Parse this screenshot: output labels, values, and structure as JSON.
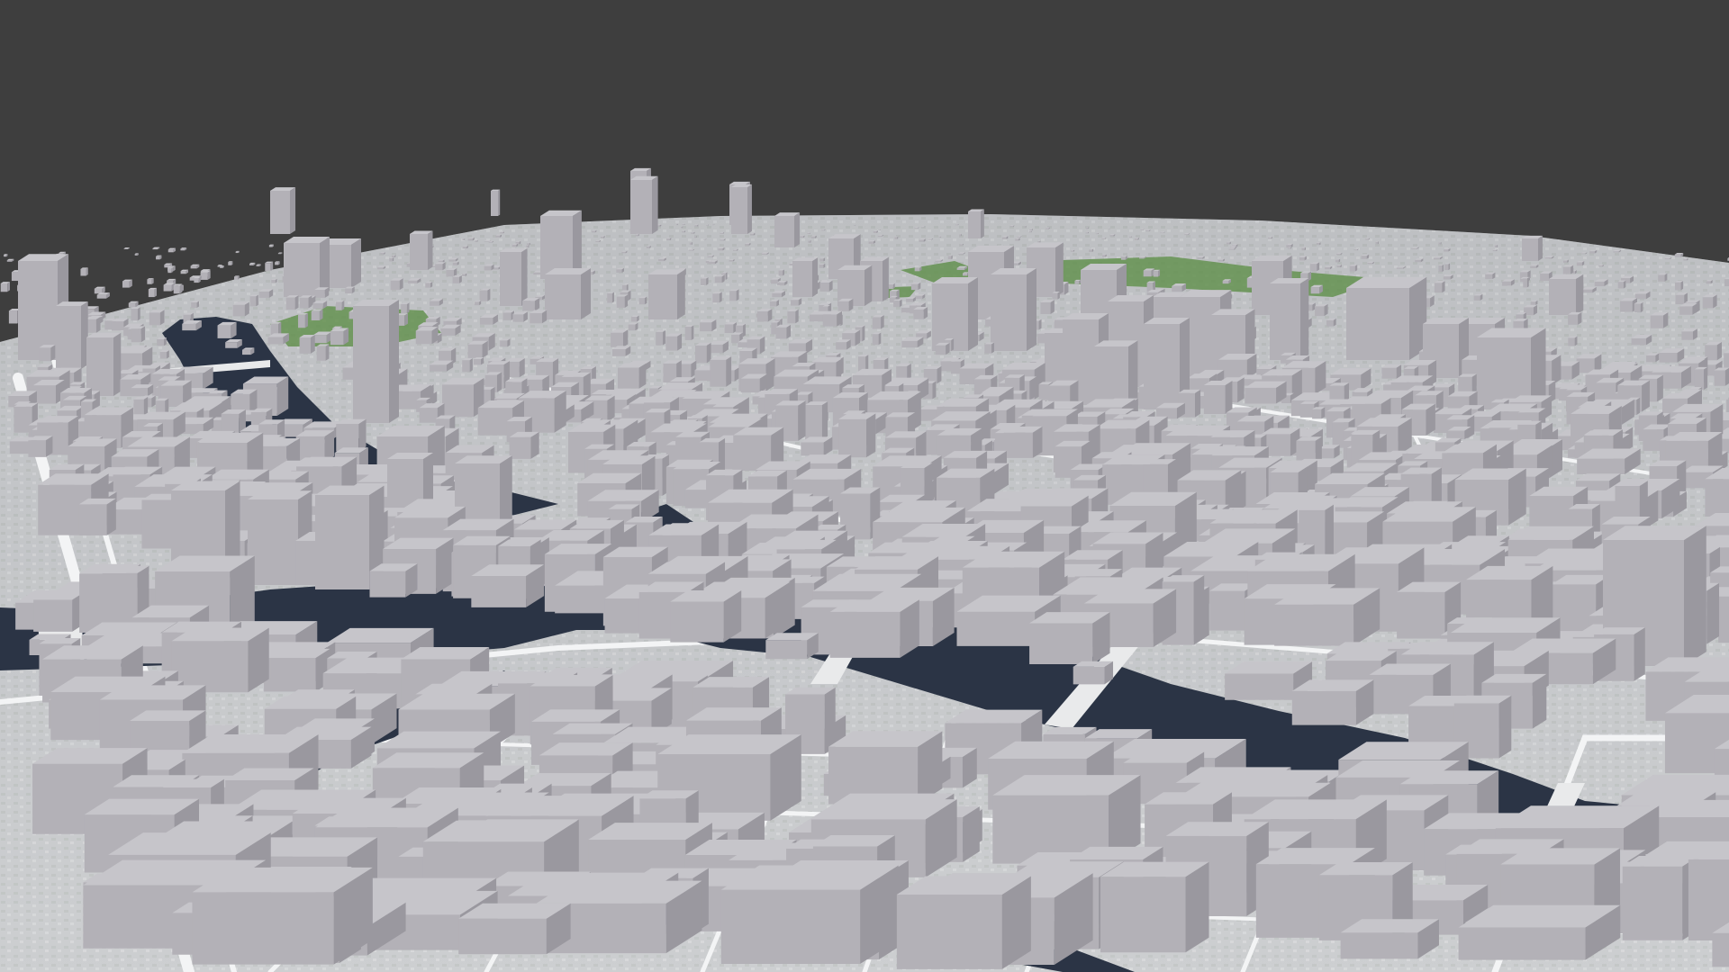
{
  "viewer": {
    "type": "3d-city-map",
    "mode": "untextured-building-massing"
  },
  "colors": {
    "sky": "#3e3e3e",
    "ground": "#c9ccce",
    "street": "#f2f3f4",
    "water": "#2b3445",
    "park": "#5f8f4a",
    "building_top": "#c6c5ca",
    "building_left": "#b3b1b7",
    "building_right": "#9a989f"
  },
  "features": {
    "main_river": "river",
    "side_channel": "canal",
    "bridges": "bridge",
    "parks": "park",
    "highrises": "tower-cluster"
  }
}
